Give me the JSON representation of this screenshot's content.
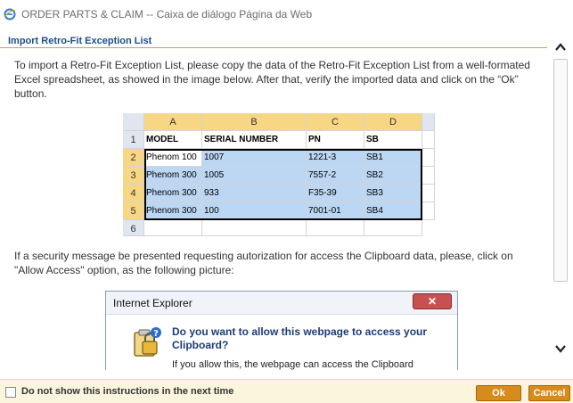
{
  "window": {
    "title": "ORDER PARTS & CLAIM -- Caixa de diálogo Página da Web",
    "icon": "ie-logo-icon"
  },
  "section": {
    "title": "Import Retro-Fit Exception List"
  },
  "content": {
    "intro": "To import a Retro-Fit Exception List, please copy the data of the Retro-Fit Exception List from a well-formated Excel spreadsheet, as showed in the image below. After that, verify the imported data and click on the “Ok” button.",
    "security": "If a security message be presented requesting autorization for access the Clipboard data, please, click on \"Allow Access\" option, as the following picture:"
  },
  "excel": {
    "columns": [
      "A",
      "B",
      "C",
      "D"
    ],
    "row_numbers": [
      "1",
      "2",
      "3",
      "4",
      "5",
      "6"
    ],
    "header": [
      "MODEL",
      "SERIAL NUMBER",
      "PN",
      "SB"
    ],
    "rows": [
      [
        "Phenom 100",
        "1007",
        "1221-3",
        "SB1"
      ],
      [
        "Phenom 300",
        "1005",
        "7557-2",
        "SB2"
      ],
      [
        "Phenom 300",
        "933",
        "F35-39",
        "SB3"
      ],
      [
        "Phenom 300",
        "100",
        "7001-01",
        "SB4"
      ]
    ]
  },
  "ie_dialog": {
    "title": "Internet Explorer",
    "close": "✕",
    "question": "Do you want to allow this webpage to access your Clipboard?",
    "body": "If you allow this, the webpage can access the Clipboard"
  },
  "footer": {
    "checkbox_label": "Do not show this instructions in the next time",
    "ok_label": "Ok",
    "cancel_label": "Cancel"
  },
  "colors": {
    "accent": "#d68b1a",
    "link": "#1b4d8f",
    "selection": "#bcd7f3"
  }
}
